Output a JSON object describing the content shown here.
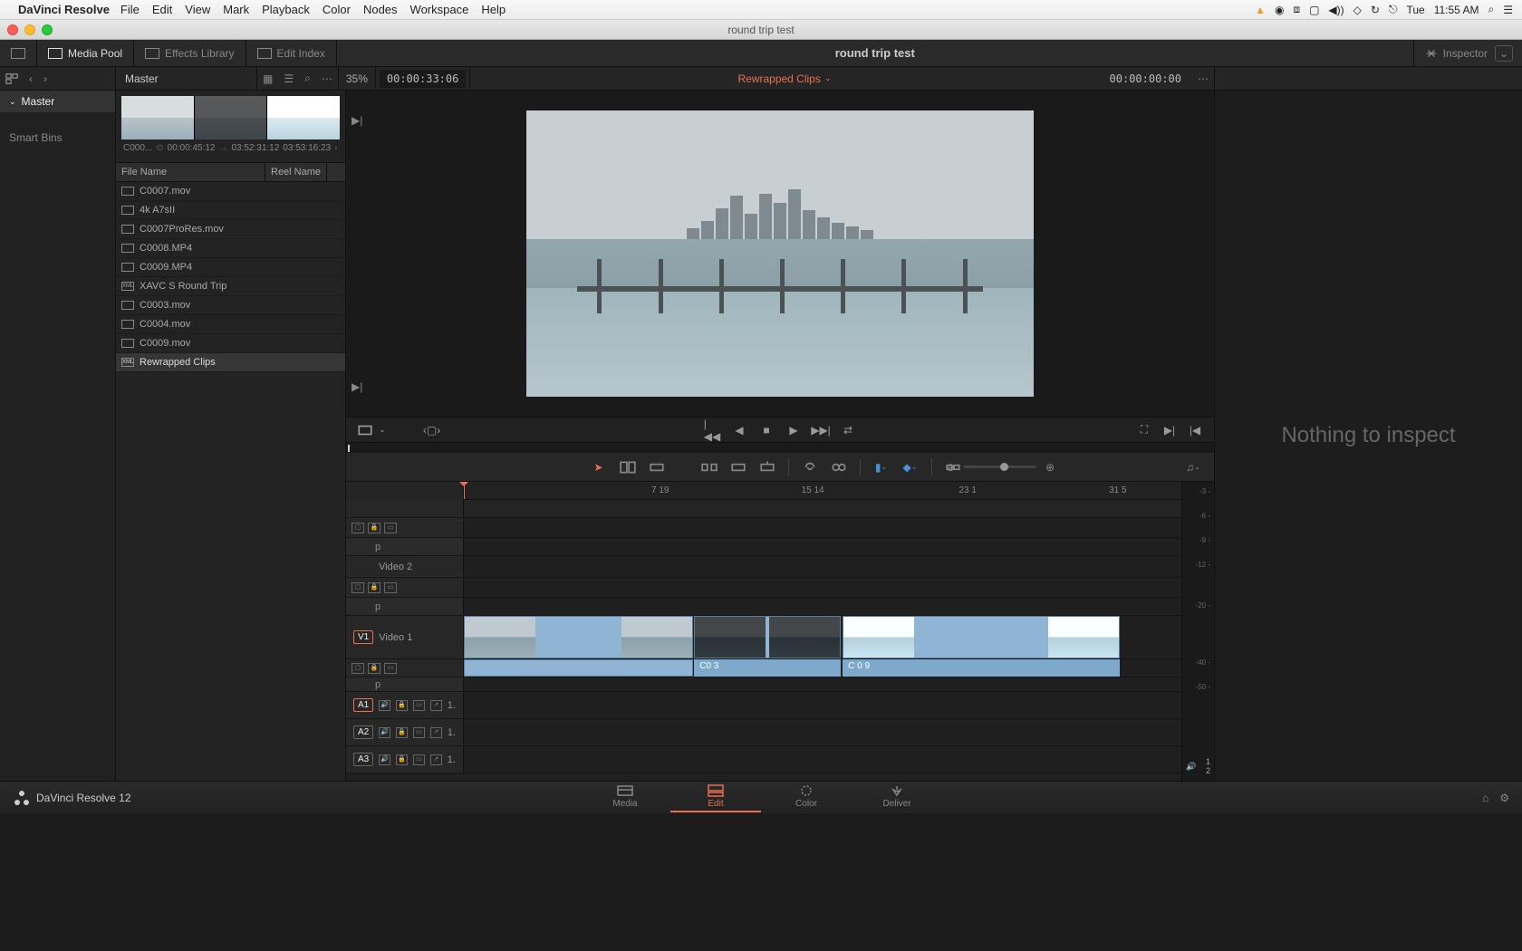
{
  "menubar": {
    "app": "DaVinci Resolve",
    "items": [
      "File",
      "Edit",
      "View",
      "Mark",
      "Playback",
      "Color",
      "Nodes",
      "Workspace",
      "Help"
    ],
    "status_day": "Tue",
    "status_time": "11:55 AM"
  },
  "window": {
    "title": "round trip test"
  },
  "toolbar": {
    "media_pool": "Media Pool",
    "effects_lib": "Effects Library",
    "edit_index": "Edit Index",
    "project_title": "round trip test",
    "inspector": "Inspector"
  },
  "secondary": {
    "breadcrumb": "Master",
    "zoom": "35%",
    "source_tc": "00:00:33:06",
    "timeline_name": "Rewrapped Clips",
    "record_tc": "00:00:00:00"
  },
  "sidebar": {
    "master": "Master",
    "smart_bins": "Smart Bins"
  },
  "media": {
    "thumb_name": "C000...",
    "thumb_dur": "00:00:45:12",
    "thumb_start": "03:52:31:12",
    "thumb_end": "03:53:16:23",
    "col_filename": "File Name",
    "col_reelname": "Reel Name",
    "files": [
      {
        "type": "clip",
        "name": "C0007.mov"
      },
      {
        "type": "clip",
        "name": "4k A7sII"
      },
      {
        "type": "clip",
        "name": "C0007ProRes.mov"
      },
      {
        "type": "clip",
        "name": "C0008.MP4"
      },
      {
        "type": "clip",
        "name": "C0009.MP4"
      },
      {
        "type": "xml",
        "name": "XAVC S Round Trip"
      },
      {
        "type": "clip",
        "name": "C0003.mov"
      },
      {
        "type": "clip",
        "name": "C0004.mov"
      },
      {
        "type": "clip",
        "name": "C0009.mov"
      },
      {
        "type": "xml",
        "name": "Rewrapped Clips",
        "selected": true
      }
    ]
  },
  "inspector": {
    "empty": "Nothing to inspect"
  },
  "timeline": {
    "ruler": [
      "7 19",
      "15 14",
      "23 1",
      "31  5"
    ],
    "v2_label": "Video 2",
    "v1_badge": "V1",
    "v1_label": "Video 1",
    "a1_badge": "A1",
    "a2_badge": "A2",
    "a3_badge": "A3",
    "audio_ch": "1.",
    "clip2_label": "C0   3",
    "clip3_label": "C 0  9",
    "p_label": "p"
  },
  "meters": {
    "levels": [
      "-3 -",
      "-6 -",
      "-9 -",
      "-12 -",
      "",
      "-20 -",
      "",
      "",
      "-40 -",
      "-50 -"
    ],
    "footer": "1  2"
  },
  "bottom": {
    "app_version": "DaVinci Resolve 12",
    "pages": [
      "Media",
      "Edit",
      "Color",
      "Deliver"
    ]
  }
}
